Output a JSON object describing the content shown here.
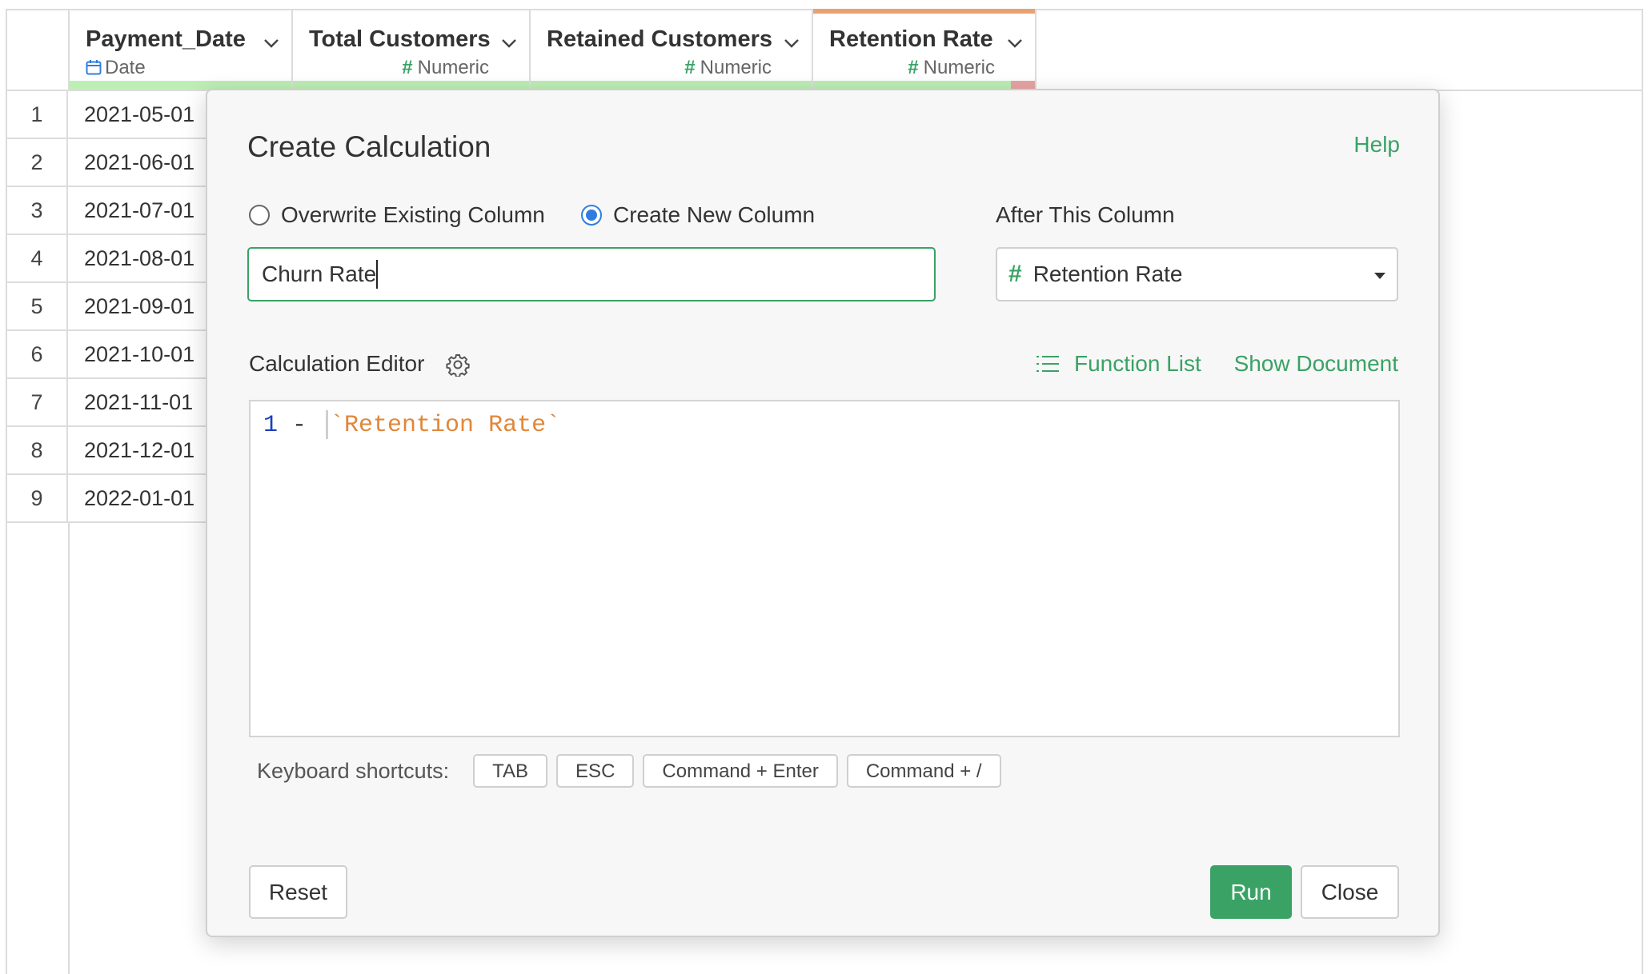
{
  "grid": {
    "columns": [
      {
        "name": "Payment_Date",
        "type": "Date",
        "type_icon": "calendar-icon"
      },
      {
        "name": "Total Customers",
        "type": "Numeric",
        "type_icon": "hash-icon"
      },
      {
        "name": "Retained Customers",
        "type": "Numeric",
        "type_icon": "hash-icon"
      },
      {
        "name": "Retention Rate",
        "type": "Numeric",
        "type_icon": "hash-icon"
      }
    ],
    "rows": [
      {
        "index": "1",
        "date": "2021-05-01"
      },
      {
        "index": "2",
        "date": "2021-06-01"
      },
      {
        "index": "3",
        "date": "2021-07-01"
      },
      {
        "index": "4",
        "date": "2021-08-01"
      },
      {
        "index": "5",
        "date": "2021-09-01"
      },
      {
        "index": "6",
        "date": "2021-10-01"
      },
      {
        "index": "7",
        "date": "2021-11-01"
      },
      {
        "index": "8",
        "date": "2021-12-01"
      },
      {
        "index": "9",
        "date": "2022-01-01"
      }
    ]
  },
  "dialog": {
    "title": "Create Calculation",
    "help_label": "Help",
    "radio_overwrite": "Overwrite Existing Column",
    "radio_new": "Create New Column",
    "selected_mode": "Create New Column",
    "after_label": "After This Column",
    "new_column_name": "Churn Rate",
    "after_column": "Retention Rate",
    "editor_label": "Calculation Editor",
    "function_list_label": "Function List",
    "show_document_label": "Show Document",
    "code": {
      "number": "1",
      "operator": " - ",
      "column_ref": "`Retention Rate`"
    },
    "shortcuts_label": "Keyboard shortcuts:",
    "shortcuts": [
      "TAB",
      "ESC",
      "Command + Enter",
      "Command + /"
    ],
    "reset_label": "Reset",
    "run_label": "Run",
    "close_label": "Close"
  },
  "colors": {
    "accent_green": "#3aa265",
    "radio_blue": "#2f7de1",
    "code_number": "#1b3fbd",
    "code_column": "#e0873a"
  }
}
